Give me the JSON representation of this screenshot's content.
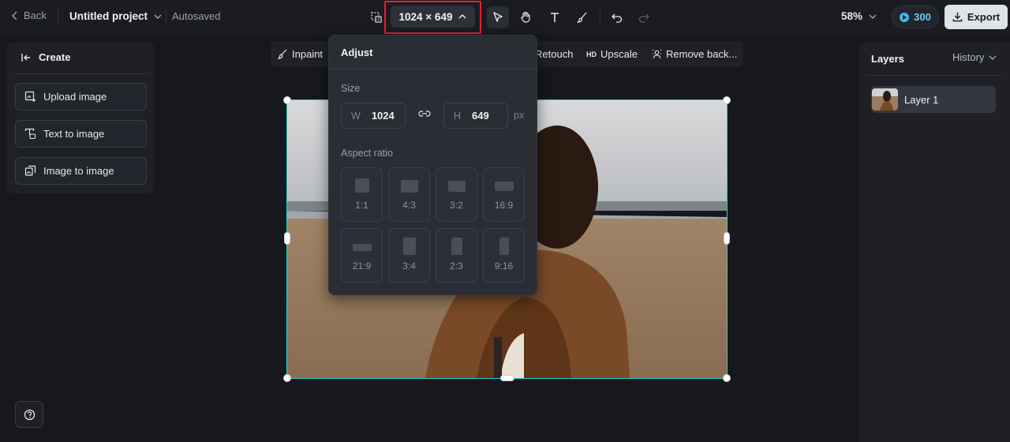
{
  "topbar": {
    "back_label": "Back",
    "project_name": "Untitled project",
    "autosaved_label": "Autosaved",
    "size_label": "1024 × 649",
    "zoom_label": "58%",
    "credits": "300",
    "export_label": "Export"
  },
  "left_panel": {
    "title": "Create",
    "buttons": [
      {
        "label": "Upload image",
        "icon": "upload-image-icon"
      },
      {
        "label": "Text to image",
        "icon": "text-to-image-icon"
      },
      {
        "label": "Image to image",
        "icon": "image-to-image-icon"
      }
    ]
  },
  "toolstrip": {
    "inpaint": "Inpaint",
    "retouch": "Retouch",
    "upscale_badge": "HD",
    "upscale": "Upscale",
    "remove_bg": "Remove back..."
  },
  "adjust_popup": {
    "title": "Adjust",
    "size_label": "Size",
    "width_key": "W",
    "width_value": "1024",
    "height_key": "H",
    "height_value": "649",
    "unit": "px",
    "aspect_label": "Aspect ratio",
    "ratios": [
      "1:1",
      "4:3",
      "3:2",
      "16:9",
      "21:9",
      "3:4",
      "2:3",
      "9:16"
    ]
  },
  "right_panel": {
    "layers_tab": "Layers",
    "history_tab": "History",
    "layer_name": "Layer 1"
  },
  "colors": {
    "accent_selection": "#2fd0c4",
    "highlight_box": "#e3232c",
    "credits_blue": "#3fb7f0"
  }
}
